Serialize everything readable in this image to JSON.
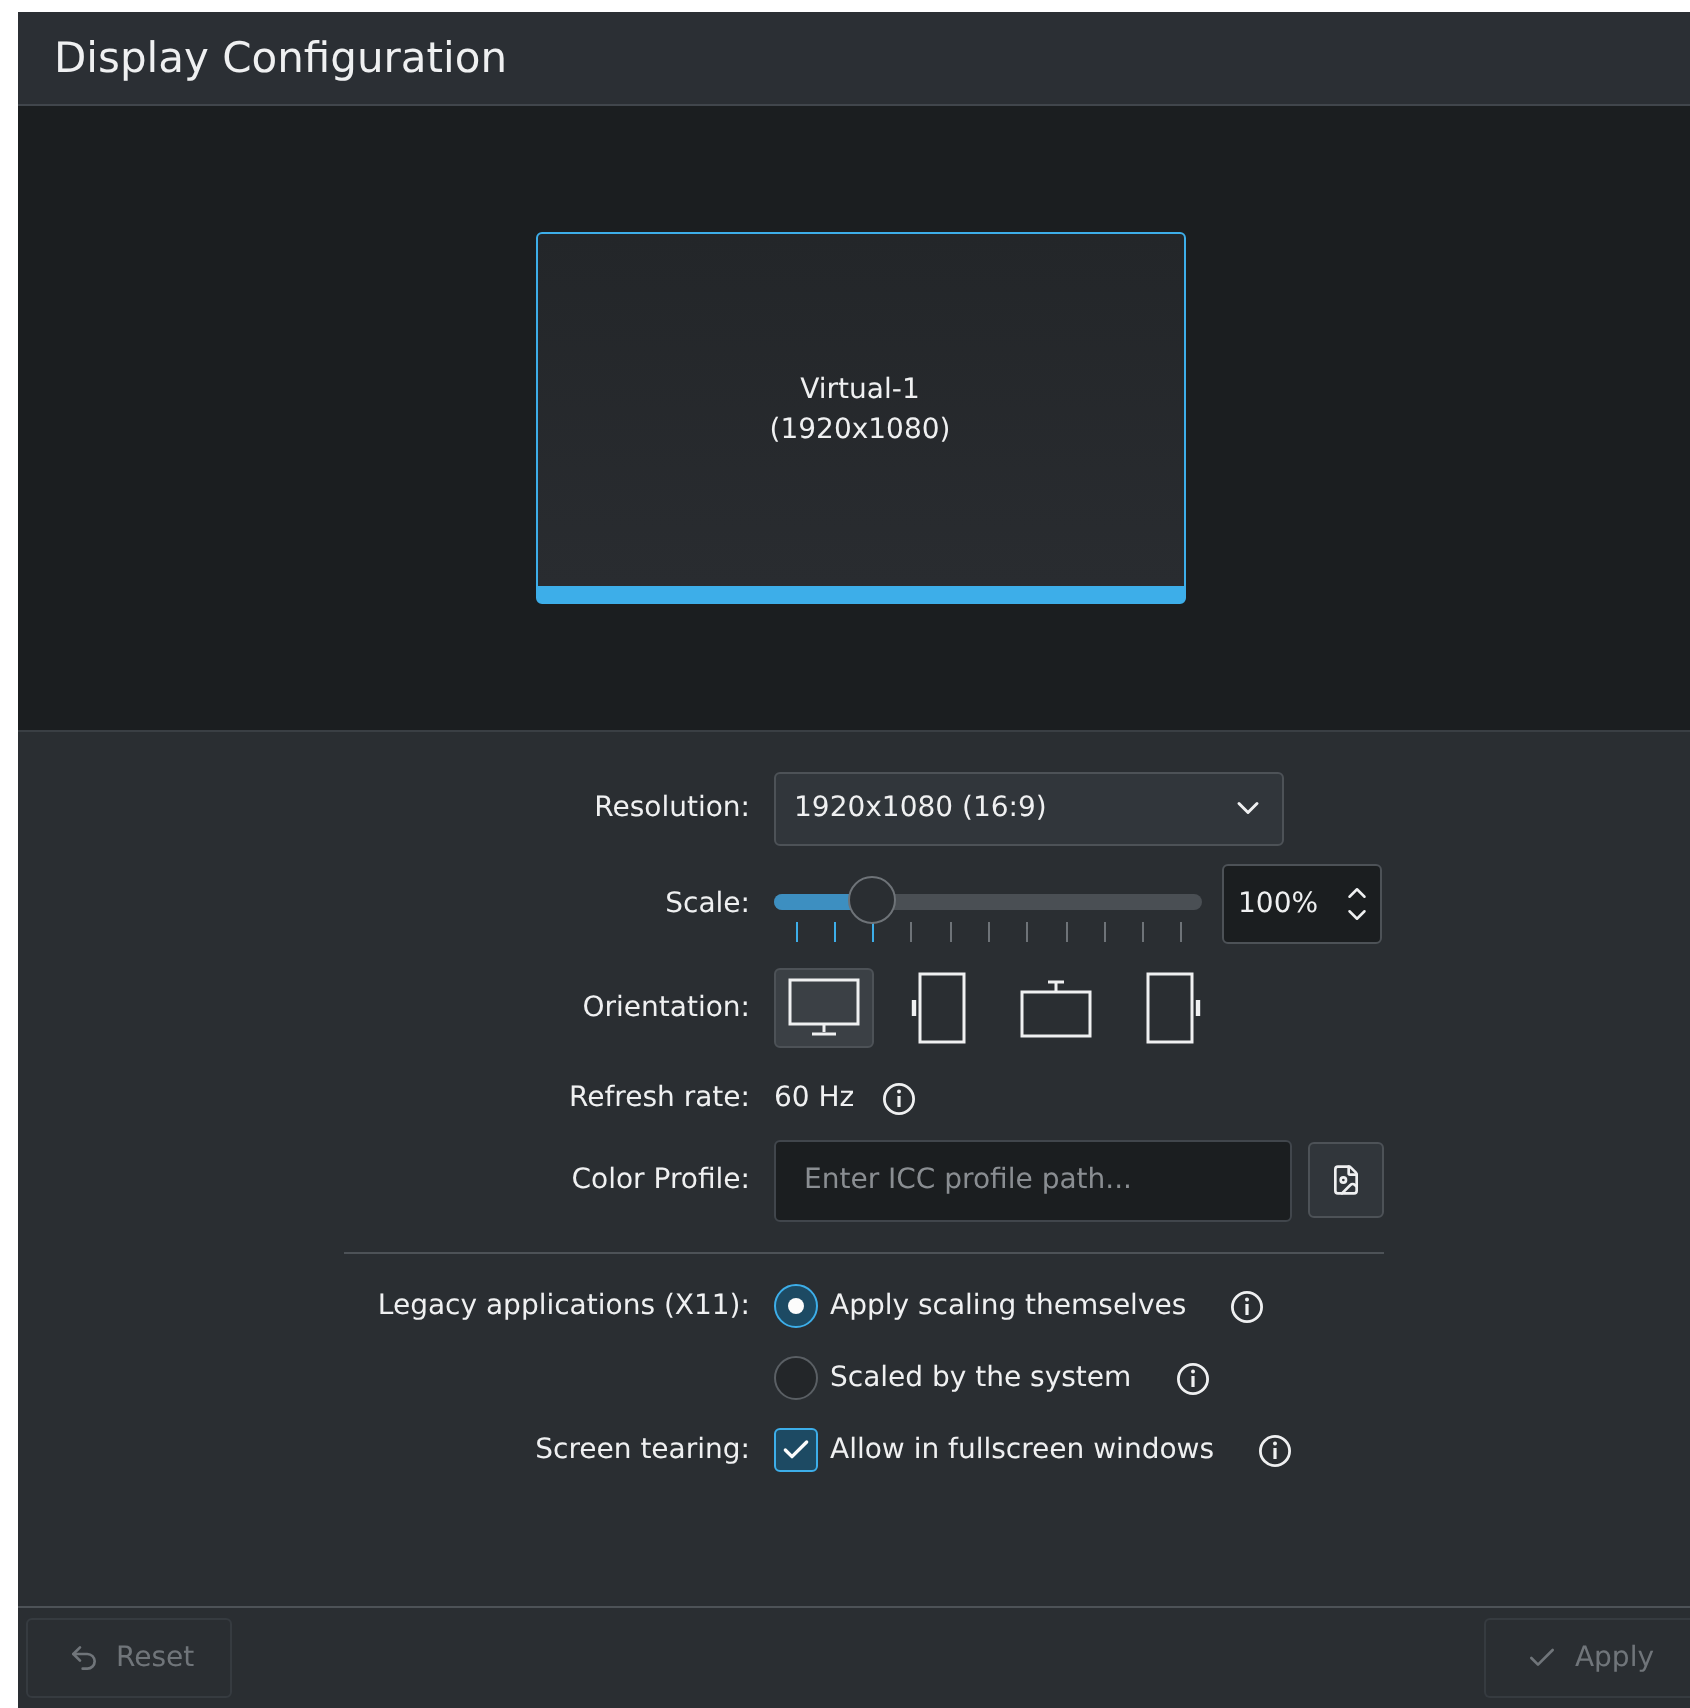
{
  "window": {
    "title": "Display Configuration"
  },
  "outputs": [
    {
      "name": "Virtual-1",
      "resolution": "(1920x1080)",
      "selected": true
    }
  ],
  "resolution": {
    "label": "Resolution:",
    "value": "1920x1080 (16:9)"
  },
  "scale": {
    "label": "Scale:",
    "level": 0.23,
    "value": "100%"
  },
  "orientation": {
    "label": "Orientation:",
    "options": [
      {
        "kind": "normal",
        "selected": true
      },
      {
        "kind": "left",
        "selected": false
      },
      {
        "kind": "inverted",
        "selected": false
      },
      {
        "kind": "right",
        "selected": false
      }
    ]
  },
  "refresh_rate": {
    "label": "Refresh rate:",
    "value": "60 Hz"
  },
  "color_profile": {
    "label": "Color Profile:",
    "placeholder": "Enter ICC profile path..."
  },
  "legacy": {
    "label": "Legacy applications (X11):",
    "options": [
      {
        "label": "Apply scaling themselves",
        "selected": true
      },
      {
        "label": "Scaled by the system",
        "selected": false
      }
    ]
  },
  "screen_tearing": {
    "label": "Screen tearing:",
    "option": "Allow in fullscreen windows",
    "checked": true
  },
  "buttons": [
    {
      "kind": "reset",
      "label": "Reset",
      "disabled": true
    },
    {
      "kind": "apply",
      "label": "Apply",
      "disabled": true
    }
  ]
}
